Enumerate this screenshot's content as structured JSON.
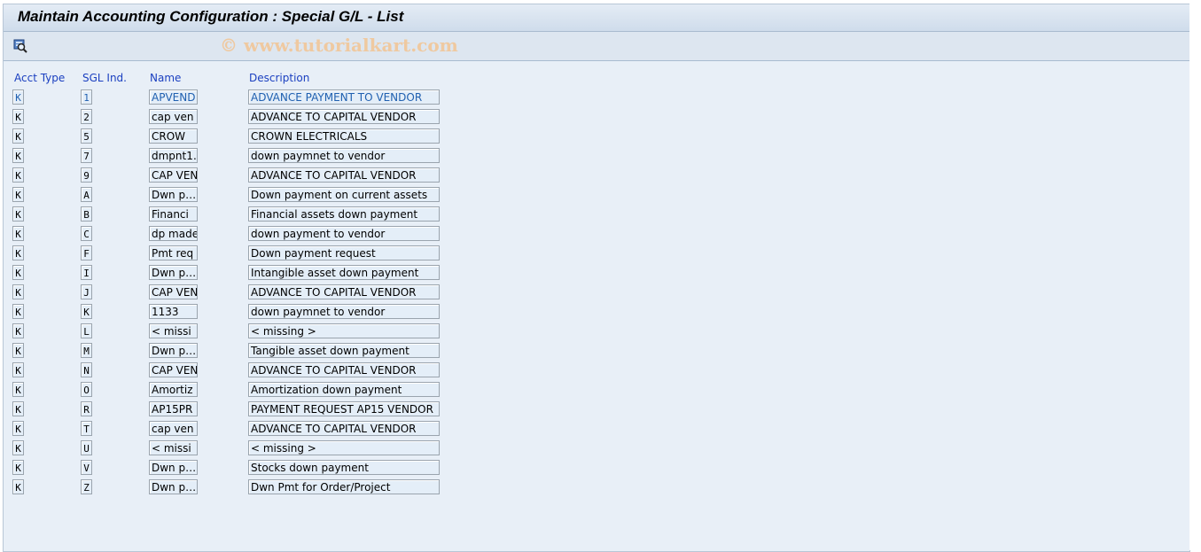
{
  "title": "Maintain Accounting Configuration : Special G/L - List",
  "toolbar": {
    "details_icon": "magnifier-details-icon"
  },
  "watermark": "© www.tutorialkart.com",
  "columns": {
    "acct_type": "Acct Type",
    "sgl_ind": "SGL Ind.",
    "name": "Name",
    "description": "Description"
  },
  "rows": [
    {
      "acct_type": "K",
      "sgl": "1",
      "name": "APVEND",
      "desc": "ADVANCE PAYMENT TO VENDOR",
      "selected": true
    },
    {
      "acct_type": "K",
      "sgl": "2",
      "name": "cap ven",
      "desc": "ADVANCE TO CAPITAL VENDOR"
    },
    {
      "acct_type": "K",
      "sgl": "5",
      "name": "CROW",
      "desc": "CROWN ELECTRICALS"
    },
    {
      "acct_type": "K",
      "sgl": "7",
      "name": "dmpnt1…",
      "desc": "down paymnet to vendor"
    },
    {
      "acct_type": "K",
      "sgl": "9",
      "name": "CAP VEN",
      "desc": "ADVANCE TO CAPITAL VENDOR"
    },
    {
      "acct_type": "K",
      "sgl": "A",
      "name": "Dwn p…",
      "desc": "Down payment on current assets"
    },
    {
      "acct_type": "K",
      "sgl": "B",
      "name": "Financi",
      "desc": "Financial assets down payment"
    },
    {
      "acct_type": "K",
      "sgl": "C",
      "name": "dp made",
      "desc": "down payment to vendor"
    },
    {
      "acct_type": "K",
      "sgl": "F",
      "name": "Pmt req",
      "desc": "Down payment request"
    },
    {
      "acct_type": "K",
      "sgl": "I",
      "name": "Dwn p…",
      "desc": "Intangible asset down payment"
    },
    {
      "acct_type": "K",
      "sgl": "J",
      "name": "CAP VEN",
      "desc": "ADVANCE TO CAPITAL VENDOR"
    },
    {
      "acct_type": "K",
      "sgl": "K",
      "name": "1133",
      "desc": "down paymnet to vendor"
    },
    {
      "acct_type": "K",
      "sgl": "L",
      "name": "< missi",
      "desc": "< missing >"
    },
    {
      "acct_type": "K",
      "sgl": "M",
      "name": "Dwn p…",
      "desc": "Tangible asset down payment"
    },
    {
      "acct_type": "K",
      "sgl": "N",
      "name": "CAP VEN",
      "desc": "ADVANCE TO CAPITAL VENDOR"
    },
    {
      "acct_type": "K",
      "sgl": "O",
      "name": "Amortiz",
      "desc": "Amortization down payment"
    },
    {
      "acct_type": "K",
      "sgl": "R",
      "name": "AP15PR",
      "desc": "PAYMENT REQUEST AP15 VENDOR"
    },
    {
      "acct_type": "K",
      "sgl": "T",
      "name": "cap ven",
      "desc": "ADVANCE TO CAPITAL VENDOR"
    },
    {
      "acct_type": "K",
      "sgl": "U",
      "name": "< missi",
      "desc": "< missing >"
    },
    {
      "acct_type": "K",
      "sgl": "V",
      "name": "Dwn p…",
      "desc": "Stocks down payment"
    },
    {
      "acct_type": "K",
      "sgl": "Z",
      "name": "Dwn p…",
      "desc": "Dwn Pmt for Order/Project"
    }
  ]
}
